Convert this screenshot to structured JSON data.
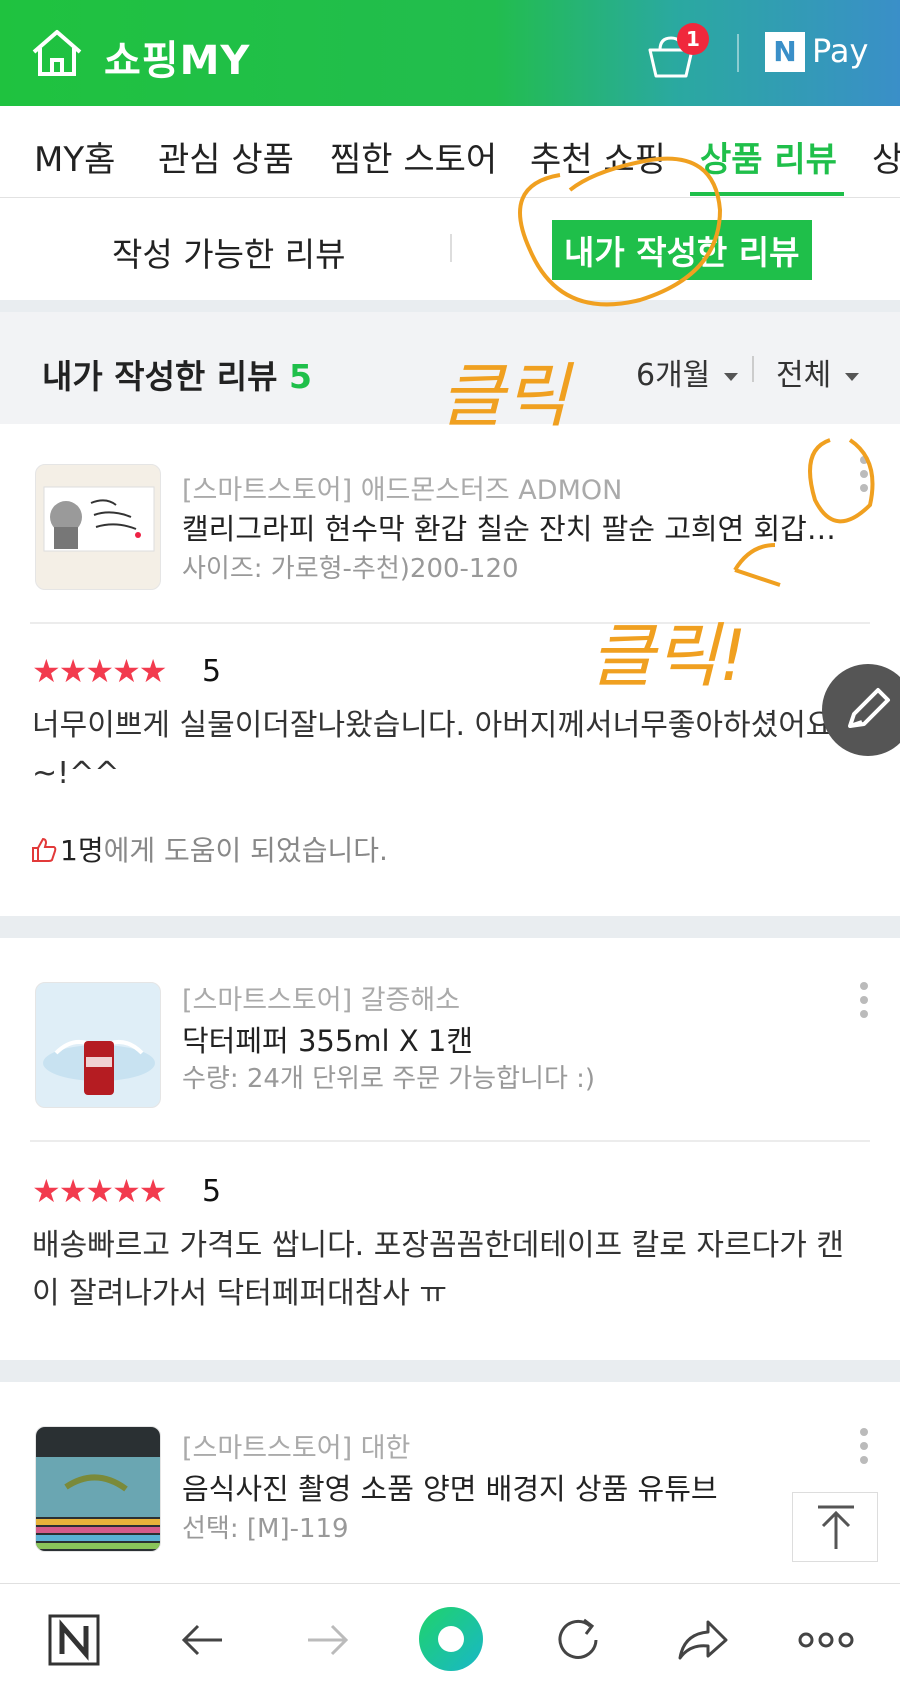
{
  "header": {
    "title": "쇼핑MY",
    "cart_count": "1",
    "pay_n": "N",
    "pay_label": "Pay",
    "gradient_colors": [
      "#1fc23f",
      "#3a8fc8"
    ]
  },
  "tabs": [
    {
      "label": "MY홈"
    },
    {
      "label": "관심 상품"
    },
    {
      "label": "찜한 스토어"
    },
    {
      "label": "추천 쇼핑"
    },
    {
      "label": "상품 리뷰"
    },
    {
      "label": "상"
    }
  ],
  "subtabs": {
    "left": "작성 가능한 리뷰",
    "right": "내가 작성한 리뷰"
  },
  "section": {
    "title": "내가 작성한 리뷰",
    "count": "5",
    "period": "6개월",
    "filter": "전체"
  },
  "reviews": [
    {
      "store": "[스마트스토어] 애드몬스터즈 ADMON",
      "product": "캘리그라피 현수막 환갑 칠순 잔치 팔순 고희연 회갑 ...",
      "option": "사이즈: 가로형-추천)200-120",
      "rating": "5",
      "text": "너무이쁘게 실물이더잘나왔습니다. 아버지께서너무좋아하셨어요~!^^",
      "helpful_count": "1명",
      "helpful_suffix": "에게 도움이 되었습니다."
    },
    {
      "store": "[스마트스토어] 갈증해소",
      "product": "닥터페퍼 355ml X 1캔",
      "option": "수량: 24개 단위로 주문 가능합니다 :)",
      "rating": "5",
      "text": "배송빠르고 가격도 쌉니다. 포장꼼꼼한데테이프 칼로 자르다가 캔이 잘려나가서 닥터페퍼대참사 ㅠ"
    },
    {
      "store": "[스마트스토어] 대한",
      "product": "음식사진 촬영 소품 양면 배경지 상품 유튜브",
      "option": "선택: [M]-119"
    }
  ],
  "annotations": {
    "click_1": "클릭",
    "click_2": "클릭!",
    "color": "#f0a020"
  },
  "colors": {
    "accent": "#1fbf4a",
    "star": "#f23b4e",
    "badge": "#f0283c"
  }
}
